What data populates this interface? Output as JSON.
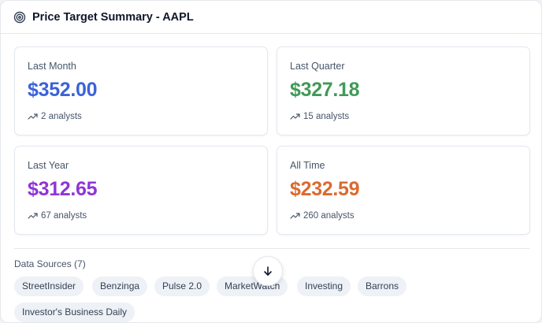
{
  "header": {
    "title": "Price Target Summary - AAPL",
    "icon": "target-icon"
  },
  "cards": [
    {
      "label": "Last Month",
      "price": "$352.00",
      "analysts": "2 analysts",
      "color": "#3b63d8"
    },
    {
      "label": "Last Quarter",
      "price": "$327.18",
      "analysts": "15 analysts",
      "color": "#3f9a57"
    },
    {
      "label": "Last Year",
      "price": "$312.65",
      "analysts": "67 analysts",
      "color": "#8e35d6"
    },
    {
      "label": "All Time",
      "price": "$232.59",
      "analysts": "260 analysts",
      "color": "#db6a2e"
    }
  ],
  "sources": {
    "title": "Data Sources (7)",
    "items": [
      "StreetInsider",
      "Benzinga",
      "Pulse 2.0",
      "MarketWatch",
      "Investing",
      "Barrons",
      "Investor's Business Daily"
    ]
  },
  "scroll_button": {
    "icon": "arrow-down-icon"
  },
  "colors": {
    "border": "#e5e7eb",
    "chip_bg": "#eef1f5",
    "muted_text": "#475569"
  }
}
